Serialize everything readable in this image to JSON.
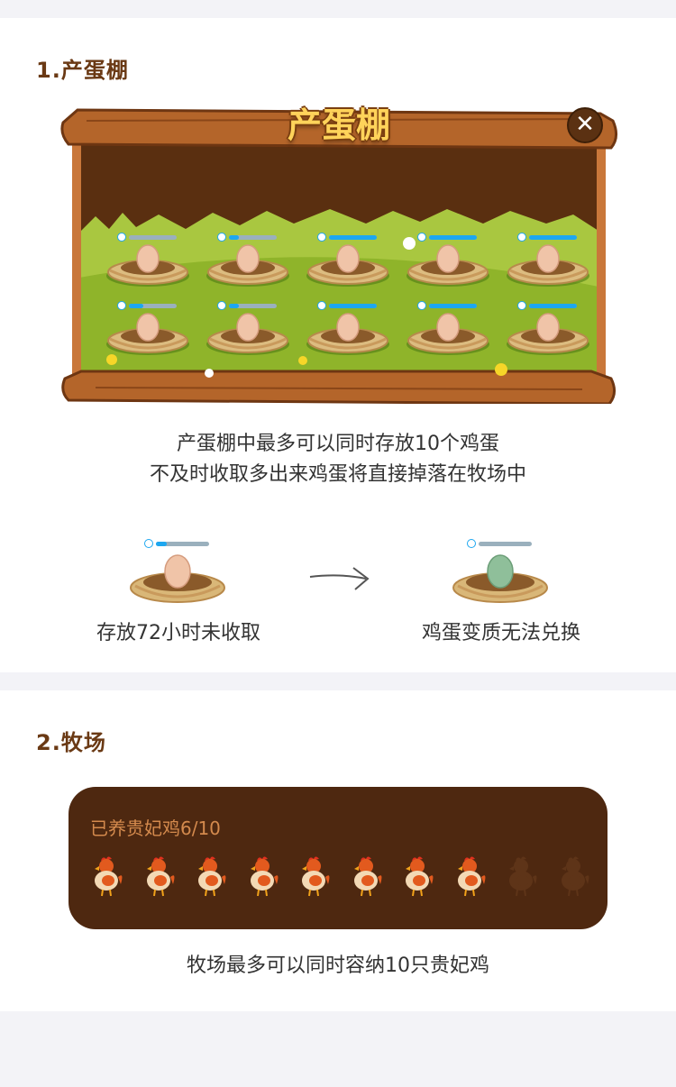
{
  "section1": {
    "title": "1.产蛋棚",
    "board": {
      "title": "产蛋棚",
      "close_icon": "close-icon",
      "nest_rows": [
        [
          {
            "progress": 0.0
          },
          {
            "progress": 0.2
          },
          {
            "progress": 1.0
          },
          {
            "progress": 1.0
          },
          {
            "progress": 1.0
          }
        ],
        [
          {
            "progress": 0.3
          },
          {
            "progress": 0.2
          },
          {
            "progress": 1.0
          },
          {
            "progress": 1.0
          },
          {
            "progress": 1.0
          }
        ]
      ]
    },
    "desc_line1": "产蛋棚中最多可以同时存放10个鸡蛋",
    "desc_line2": "不及时收取多出来鸡蛋将直接掉落在牧场中",
    "example_fresh": {
      "caption": "存放72小时未收取",
      "progress": 0.2
    },
    "example_spoiled": {
      "caption": "鸡蛋变质无法兑换",
      "progress": 0.0
    }
  },
  "section2": {
    "title": "2.牧场",
    "ranch_label": "已养贵妃鸡6/10",
    "hens_raised": 8,
    "hens_capacity": 10,
    "desc": "牧场最多可以同时容纳10只贵妃鸡"
  },
  "colors": {
    "brand_brown": "#6a3914",
    "progress_blue": "#1da7f0",
    "ranch_bg": "#4e2810",
    "ranch_label": "#d48a4d"
  }
}
